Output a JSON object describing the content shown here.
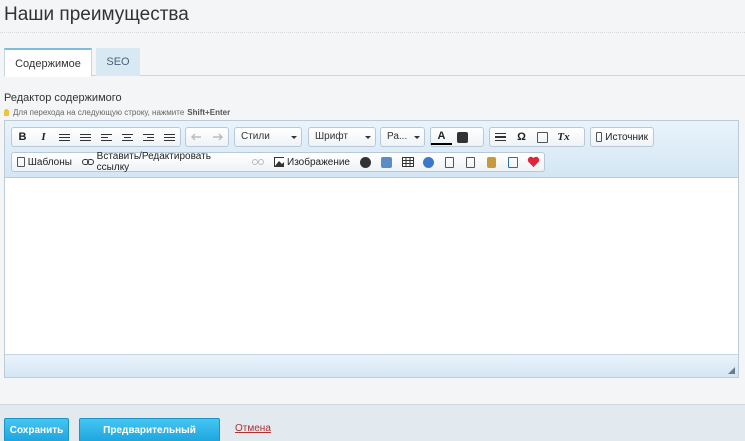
{
  "page": {
    "title": "Наши преимущества"
  },
  "tabs": [
    {
      "label": "Содержимое",
      "active": true
    },
    {
      "label": "SEO",
      "active": false
    }
  ],
  "field": {
    "label": "Редактор содержимого",
    "hint_text": "Для перехода на следующую строку, нажмите",
    "hint_key": "Shift+Enter"
  },
  "toolbar": {
    "row1": {
      "bold": "B",
      "italic": "I",
      "combos": {
        "styles": "Стили",
        "font": "Шрифт",
        "size": "Ра..."
      },
      "source_label": "Источник",
      "omega": "Ω",
      "text_color": "A",
      "remove_format": "Tx"
    },
    "row2": {
      "templates_label": "Шаблоны",
      "link_label": "Вставить/Редактировать ссылку",
      "image_label": "Изображение"
    }
  },
  "footer": {
    "save_label": "Сохранить",
    "preview_label": "Предварительный просмотр",
    "cancel_label": "Отмена"
  },
  "colors": {
    "accent": "#1ea6df",
    "cancel_link": "#b03030",
    "heart": "#e0243a"
  }
}
